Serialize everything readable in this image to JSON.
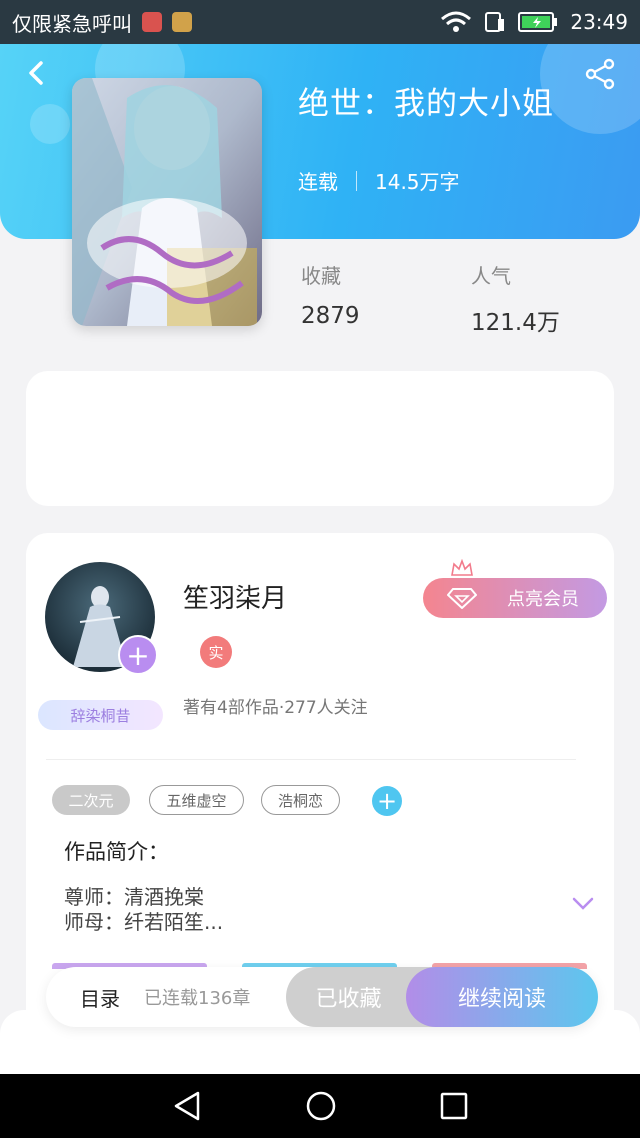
{
  "status_bar": {
    "carrier_text": "仅限紧急呼叫",
    "time": "23:49",
    "icons": [
      "hms-icon",
      "app-icon",
      "wifi-icon",
      "sim-icon",
      "battery-charging-icon"
    ]
  },
  "header": {
    "back_icon": "chevron-left-icon",
    "share_icon": "share-icon",
    "title": "绝世：我的大小姐",
    "status": "连载",
    "word_count": "14.5万字",
    "accent_colors": [
      "#56d3f7",
      "#3b9bf2"
    ]
  },
  "stats": {
    "favorites_label": "收藏",
    "favorites_value": "2879",
    "popularity_label": "人气",
    "popularity_value": "121.4万"
  },
  "author": {
    "name": "笙羽柒月",
    "real_badge": "实",
    "tag": "辞染桐昔",
    "stats": "著有4部作品·277人关注",
    "vip_button": "点亮会员"
  },
  "tags": [
    "二次元",
    "五维虚空",
    "浩桐恋"
  ],
  "intro": {
    "title": "作品简介：",
    "line1": "尊师：清酒挽棠",
    "line2": "师母：纤若陌笙..."
  },
  "bottom_bar": {
    "toc_label": "目录",
    "toc_count": "已连载136章",
    "collected_label": "已收藏",
    "continue_label": "继续阅读"
  },
  "nav": {
    "icons": [
      "back-triangle-icon",
      "home-circle-icon",
      "recents-square-icon"
    ]
  }
}
